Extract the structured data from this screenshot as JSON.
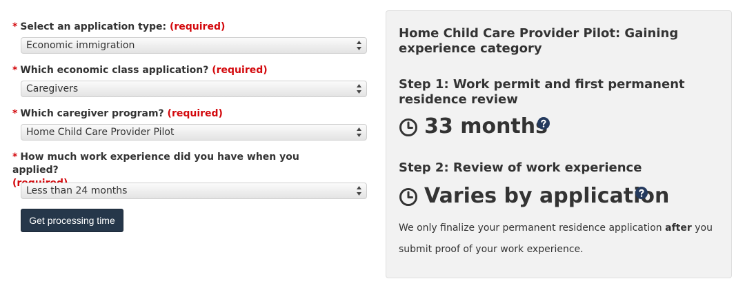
{
  "form": {
    "required_marker": "*",
    "required_text": "(required)",
    "q1": {
      "label": "Select an application type:",
      "selected": "Economic immigration"
    },
    "q2": {
      "label": "Which economic class application?",
      "selected": "Caregivers"
    },
    "q3": {
      "label": "Which caregiver program?",
      "selected": "Home Child Care Provider Pilot"
    },
    "q4": {
      "label": "How much work experience did you have when you applied?",
      "selected": "Less than 24 months"
    },
    "submit_label": "Get processing time"
  },
  "result": {
    "title": "Home Child Care Provider Pilot: Gaining experience category",
    "step1": {
      "heading": "Step 1: Work permit and first permanent residence review",
      "time": "33 months"
    },
    "step2": {
      "heading": "Step 2: Review of work experience",
      "time": "Varies by application"
    },
    "note_before": "We only finalize your permanent residence application ",
    "note_bold": "after",
    "note_after": " you submit proof of your work experience."
  },
  "icons": {
    "clock": "clock-icon",
    "help": "question-circle-icon",
    "select_arrows": "sort-arrows-icon"
  },
  "colors": {
    "required_red": "#d3080c",
    "button_navy": "#26374a",
    "help_icon_navy": "#243a5e",
    "panel_gray": "#f2f2f2"
  }
}
